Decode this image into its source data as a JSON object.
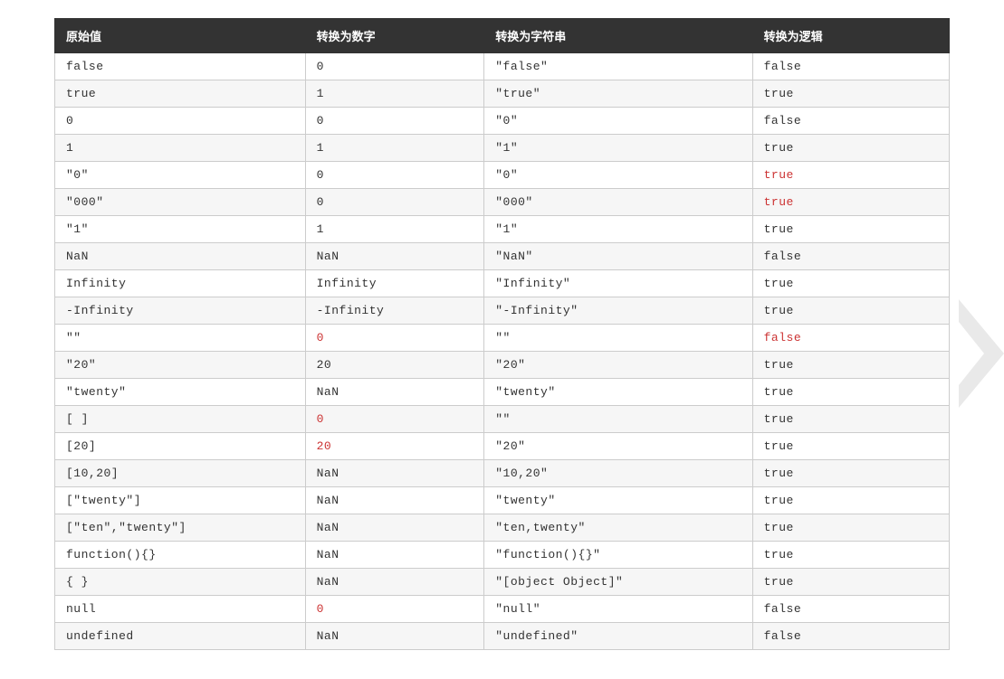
{
  "headers": [
    "原始值",
    "转换为数字",
    "转换为字符串",
    "转换为逻辑"
  ],
  "rows": [
    {
      "cells": [
        {
          "t": "false"
        },
        {
          "t": "0"
        },
        {
          "t": "\"false\""
        },
        {
          "t": "false"
        }
      ]
    },
    {
      "cells": [
        {
          "t": "true"
        },
        {
          "t": "1"
        },
        {
          "t": "\"true\""
        },
        {
          "t": "true"
        }
      ]
    },
    {
      "cells": [
        {
          "t": "0"
        },
        {
          "t": "0"
        },
        {
          "t": "\"0\""
        },
        {
          "t": "false"
        }
      ]
    },
    {
      "cells": [
        {
          "t": "1"
        },
        {
          "t": "1"
        },
        {
          "t": "\"1\""
        },
        {
          "t": "true"
        }
      ]
    },
    {
      "cells": [
        {
          "t": "\"0\""
        },
        {
          "t": "0"
        },
        {
          "t": "\"0\""
        },
        {
          "t": "true",
          "hl": true
        }
      ]
    },
    {
      "cells": [
        {
          "t": "\"000\""
        },
        {
          "t": "0"
        },
        {
          "t": "\"000\""
        },
        {
          "t": "true",
          "hl": true
        }
      ]
    },
    {
      "cells": [
        {
          "t": "\"1\""
        },
        {
          "t": "1"
        },
        {
          "t": "\"1\""
        },
        {
          "t": "true"
        }
      ]
    },
    {
      "cells": [
        {
          "t": "NaN"
        },
        {
          "t": "NaN"
        },
        {
          "t": "\"NaN\""
        },
        {
          "t": "false"
        }
      ]
    },
    {
      "cells": [
        {
          "t": "Infinity"
        },
        {
          "t": "Infinity"
        },
        {
          "t": "\"Infinity\""
        },
        {
          "t": "true"
        }
      ]
    },
    {
      "cells": [
        {
          "t": "-Infinity"
        },
        {
          "t": "-Infinity"
        },
        {
          "t": "\"-Infinity\""
        },
        {
          "t": "true"
        }
      ]
    },
    {
      "cells": [
        {
          "t": "\"\""
        },
        {
          "t": "0",
          "hl": true
        },
        {
          "t": "\"\""
        },
        {
          "t": "false",
          "hl": true
        }
      ]
    },
    {
      "cells": [
        {
          "t": "\"20\""
        },
        {
          "t": "20"
        },
        {
          "t": "\"20\""
        },
        {
          "t": "true"
        }
      ]
    },
    {
      "cells": [
        {
          "t": "\"twenty\""
        },
        {
          "t": "NaN"
        },
        {
          "t": "\"twenty\""
        },
        {
          "t": "true"
        }
      ]
    },
    {
      "cells": [
        {
          "t": "[ ]"
        },
        {
          "t": "0",
          "hl": true
        },
        {
          "t": "\"\""
        },
        {
          "t": "true"
        }
      ]
    },
    {
      "cells": [
        {
          "t": "[20]"
        },
        {
          "t": "20",
          "hl": true
        },
        {
          "t": "\"20\""
        },
        {
          "t": "true"
        }
      ]
    },
    {
      "cells": [
        {
          "t": "[10,20]"
        },
        {
          "t": "NaN"
        },
        {
          "t": "\"10,20\""
        },
        {
          "t": "true"
        }
      ]
    },
    {
      "cells": [
        {
          "t": "[\"twenty\"]"
        },
        {
          "t": "NaN"
        },
        {
          "t": "\"twenty\""
        },
        {
          "t": "true"
        }
      ]
    },
    {
      "cells": [
        {
          "t": "[\"ten\",\"twenty\"]"
        },
        {
          "t": "NaN"
        },
        {
          "t": "\"ten,twenty\""
        },
        {
          "t": "true"
        }
      ]
    },
    {
      "cells": [
        {
          "t": "function(){}"
        },
        {
          "t": "NaN"
        },
        {
          "t": "\"function(){}\""
        },
        {
          "t": "true"
        }
      ]
    },
    {
      "cells": [
        {
          "t": "{ }"
        },
        {
          "t": "NaN"
        },
        {
          "t": "\"[object Object]\""
        },
        {
          "t": "true"
        }
      ]
    },
    {
      "cells": [
        {
          "t": "null"
        },
        {
          "t": "0",
          "hl": true
        },
        {
          "t": "\"null\""
        },
        {
          "t": "false"
        }
      ]
    },
    {
      "cells": [
        {
          "t": "undefined"
        },
        {
          "t": "NaN"
        },
        {
          "t": "\"undefined\""
        },
        {
          "t": "false"
        }
      ]
    }
  ]
}
